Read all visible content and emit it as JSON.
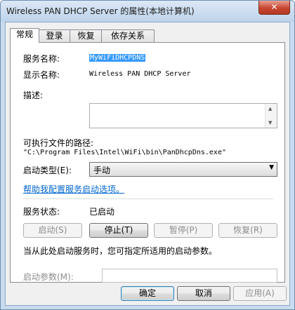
{
  "window": {
    "title": "Wireless PAN DHCP Server 的属性(本地计算机)",
    "close_glyph": "✕"
  },
  "tabs": [
    {
      "label": "常规",
      "active": true
    },
    {
      "label": "登录",
      "active": false
    },
    {
      "label": "恢复",
      "active": false
    },
    {
      "label": "依存关系",
      "active": false
    }
  ],
  "general": {
    "service_name_label": "服务名称:",
    "service_name_value": "MyWiFiDHCPDNS",
    "display_name_label": "显示名称:",
    "display_name_value": "Wireless PAN DHCP Server",
    "description_label": "描述:",
    "description_value": "",
    "path_label": "可执行文件的路径:",
    "path_value": "\"C:\\Program Files\\Intel\\WiFi\\bin\\PanDhcpDns.exe\"",
    "startup_type_label": "启动类型(E):",
    "startup_type_value": "手动",
    "help_link": "帮助我配置服务启动选项。",
    "status_label": "服务状态:",
    "status_value": "已启动",
    "start_button": "启动(S)",
    "stop_button": "停止(T)",
    "pause_button": "暂停(P)",
    "resume_button": "恢复(R)",
    "hint_text": "当从此处启动服务时，您可指定所适用的启动参数。",
    "start_params_label": "启动参数(M):",
    "start_params_value": ""
  },
  "footer": {
    "ok_button": "确定",
    "cancel_button": "取消",
    "apply_button": "应用(A)"
  },
  "colors": {
    "accent": "#3399ff",
    "link": "#0066cc",
    "close": "#c8452f"
  },
  "icons": {
    "close": "close-icon",
    "scroll_up": "chevron-up-icon",
    "scroll_down": "chevron-down-icon",
    "combo_arrow": "chevron-down-icon"
  }
}
